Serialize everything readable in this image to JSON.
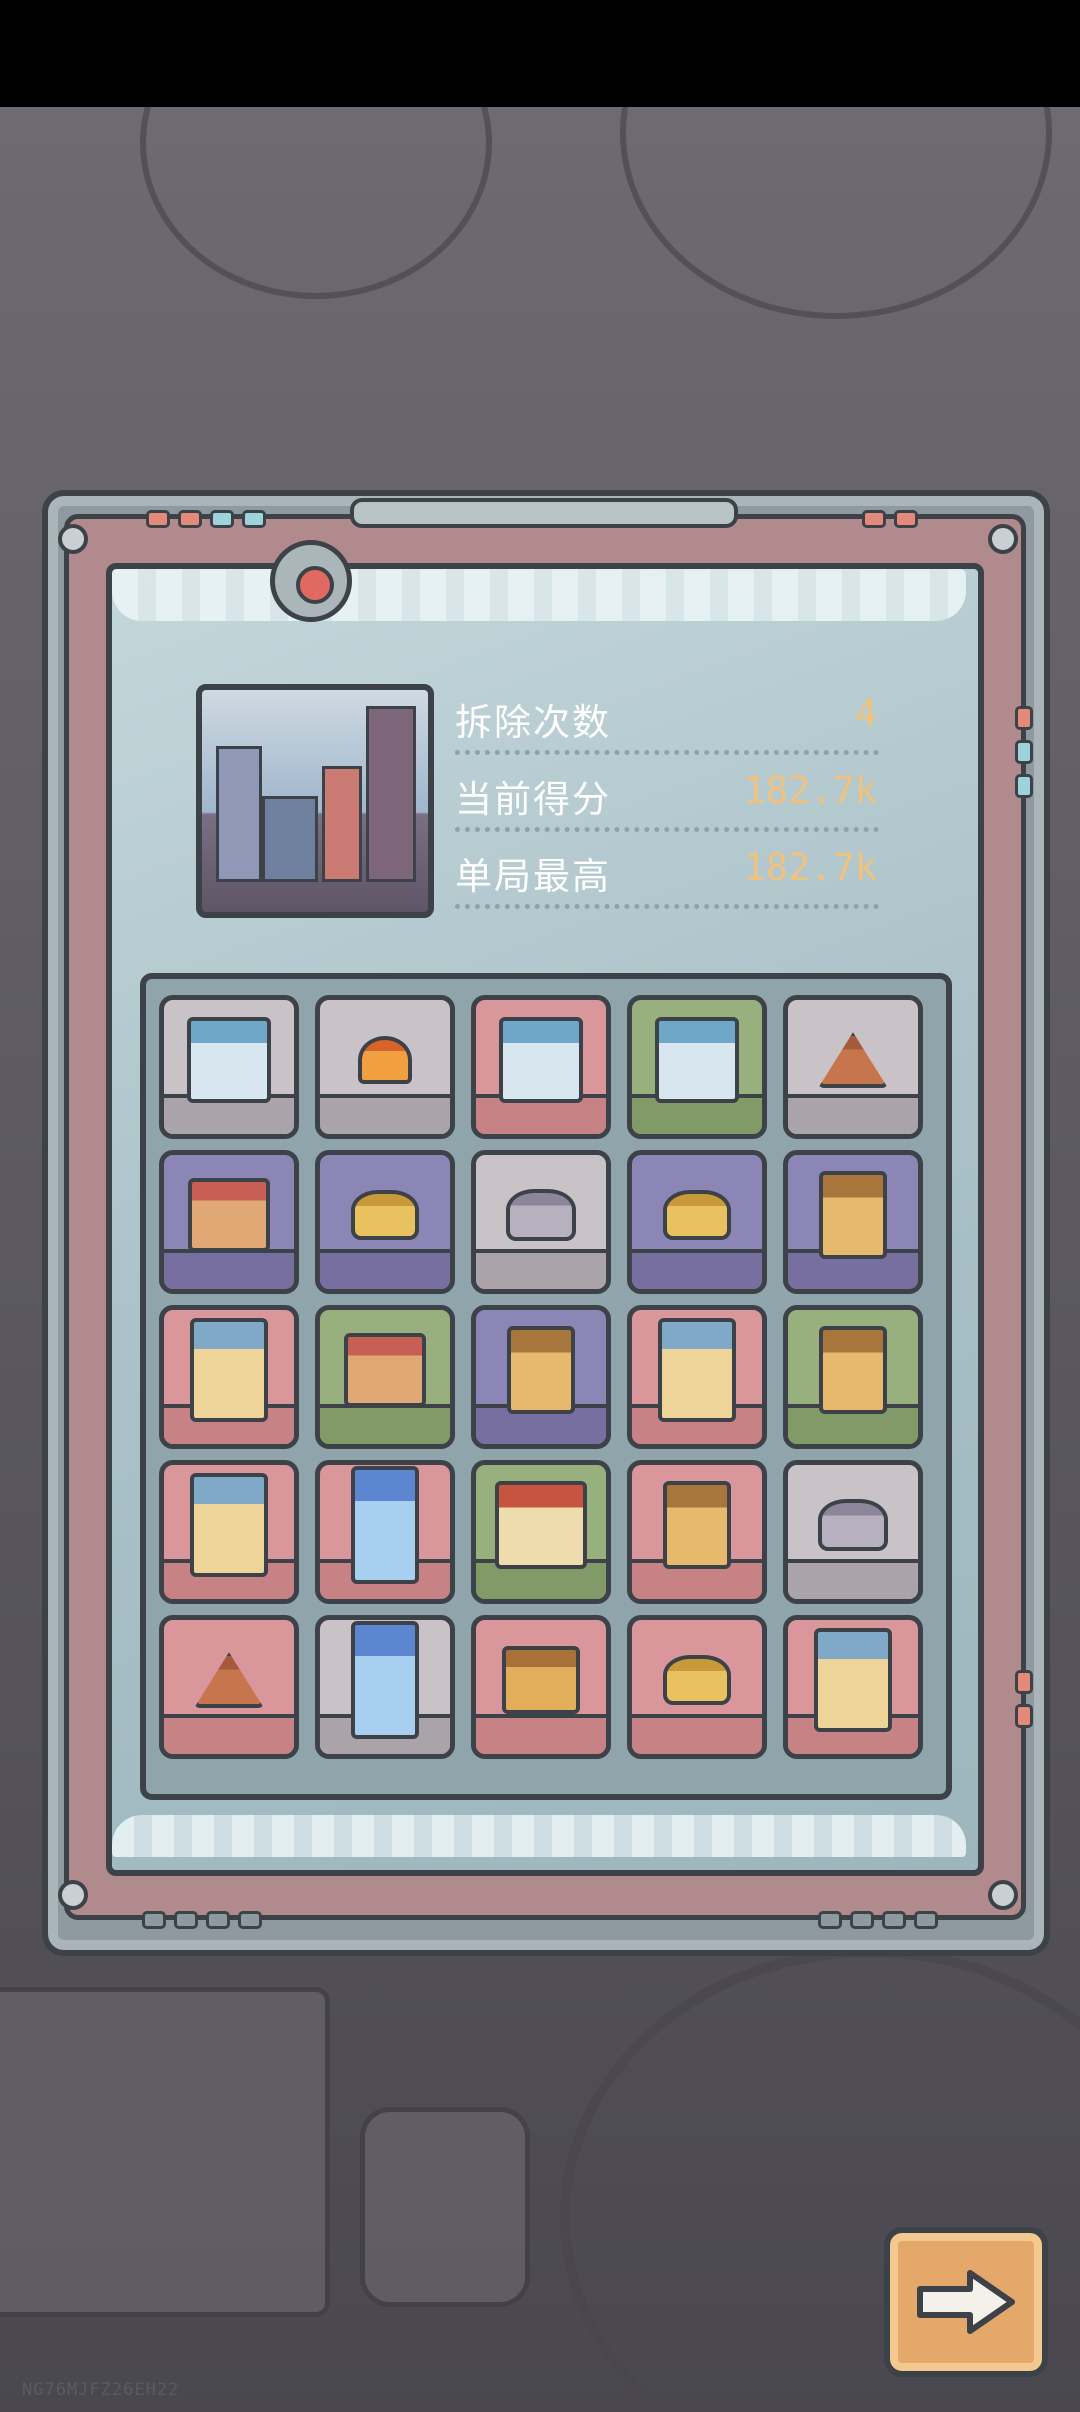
{
  "stats": {
    "demolish_label": "拆除次数",
    "demolish_value": "4",
    "score_label": "当前得分",
    "score_value": "182.7k",
    "best_label": "单局最高",
    "best_value": "182.7k"
  },
  "board": {
    "tiles": [
      {
        "building": "ice-palace",
        "ground": "snow"
      },
      {
        "building": "campfire",
        "ground": "snow"
      },
      {
        "building": "ice-palace",
        "ground": "pink"
      },
      {
        "building": "ice-palace",
        "ground": "green"
      },
      {
        "building": "tent",
        "ground": "snow"
      },
      {
        "building": "wooden-house",
        "ground": "purple"
      },
      {
        "building": "haystack",
        "ground": "purple"
      },
      {
        "building": "rock",
        "ground": "snow"
      },
      {
        "building": "haystack",
        "ground": "purple"
      },
      {
        "building": "watchtower",
        "ground": "purple"
      },
      {
        "building": "skyscraper",
        "ground": "pink"
      },
      {
        "building": "wooden-house",
        "ground": "green"
      },
      {
        "building": "watchtower",
        "ground": "purple"
      },
      {
        "building": "skyscraper",
        "ground": "pink"
      },
      {
        "building": "watchtower",
        "ground": "green"
      },
      {
        "building": "skyscraper",
        "ground": "pink"
      },
      {
        "building": "crystal-tower",
        "ground": "pink"
      },
      {
        "building": "palace",
        "ground": "green"
      },
      {
        "building": "watchtower",
        "ground": "pink"
      },
      {
        "building": "rock",
        "ground": "snow"
      },
      {
        "building": "tent",
        "ground": "pink"
      },
      {
        "building": "crystal-tower",
        "ground": "snow"
      },
      {
        "building": "hut",
        "ground": "pink"
      },
      {
        "building": "haystack",
        "ground": "pink"
      },
      {
        "building": "skyscraper",
        "ground": "pink"
      }
    ]
  },
  "next_button": {
    "icon": "arrow-right-icon"
  },
  "watermark": "NG76MJFZ26EH22",
  "colors": {
    "label": "#ffffff",
    "value": "#f1c27d",
    "frame": "#8e9aa0",
    "button": "#e4a96a"
  }
}
